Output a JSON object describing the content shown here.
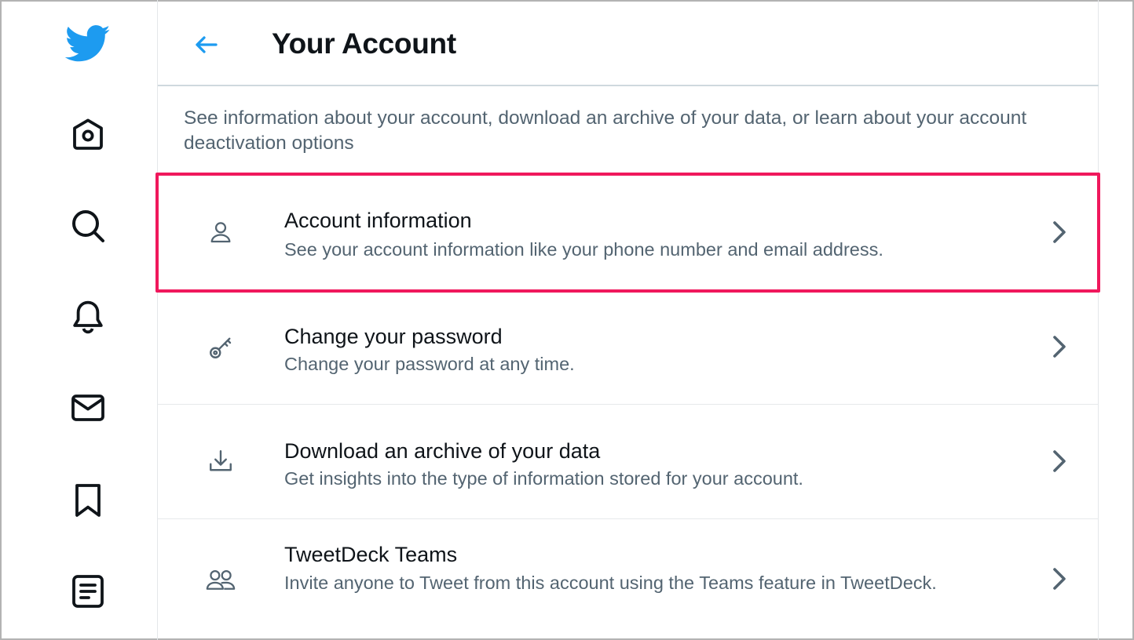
{
  "header": {
    "title": "Your Account",
    "back_icon": "arrow-left-icon"
  },
  "description": "See information about your account, download an archive of your data, or learn about your account deactivation options",
  "sidebar": {
    "items": [
      {
        "name": "twitter-logo",
        "icon": "twitter-bird-icon"
      },
      {
        "name": "home",
        "icon": "home-icon"
      },
      {
        "name": "explore",
        "icon": "search-icon"
      },
      {
        "name": "notifications",
        "icon": "bell-icon"
      },
      {
        "name": "messages",
        "icon": "mail-icon"
      },
      {
        "name": "bookmarks",
        "icon": "bookmark-icon"
      },
      {
        "name": "lists",
        "icon": "list-icon"
      }
    ]
  },
  "settings": [
    {
      "title": "Account information",
      "subtitle": "See your account information like your phone number and email address.",
      "icon": "person-icon",
      "highlighted": true
    },
    {
      "title": "Change your password",
      "subtitle": "Change your password at any time.",
      "icon": "key-icon",
      "highlighted": false
    },
    {
      "title": "Download an archive of your data",
      "subtitle": "Get insights into the type of information stored for your account.",
      "icon": "download-icon",
      "highlighted": false
    },
    {
      "title": "TweetDeck Teams",
      "subtitle": "Invite anyone to Tweet from this account using the Teams feature in TweetDeck.",
      "icon": "people-icon",
      "highlighted": false
    }
  ],
  "colors": {
    "accent": "#1d9bf0",
    "highlight": "#f0185c",
    "text_primary": "#0f1419",
    "text_secondary": "#536471",
    "icon": "#536471"
  }
}
